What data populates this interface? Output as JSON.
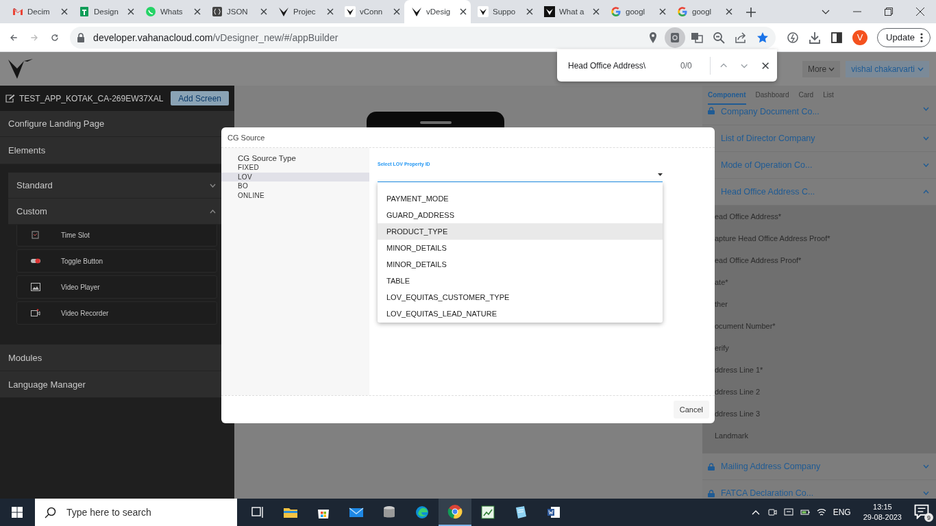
{
  "browser": {
    "tabs": [
      {
        "title": "Decim",
        "kind": "gmail",
        "selected": false
      },
      {
        "title": "Design",
        "kind": "sheets",
        "selected": false
      },
      {
        "title": "Whats",
        "kind": "whatsapp",
        "selected": false
      },
      {
        "title": "JSON",
        "kind": "json",
        "selected": false
      },
      {
        "title": "Projec",
        "kind": "vplain",
        "selected": false
      },
      {
        "title": "vConn",
        "kind": "vbox",
        "selected": false
      },
      {
        "title": "vDesig",
        "kind": "vplain",
        "selected": true
      },
      {
        "title": "Suppo",
        "kind": "vbox",
        "selected": false
      },
      {
        "title": "What a",
        "kind": "vblack",
        "selected": false
      },
      {
        "title": "googl",
        "kind": "google",
        "selected": false
      },
      {
        "title": "googl",
        "kind": "google",
        "selected": false
      }
    ],
    "address": {
      "host": "developer.vahanacloud.com",
      "path": "/vDesigner_new/#/appBuilder"
    },
    "profile_initial": "V",
    "update_button": "Update"
  },
  "find_bar": {
    "query": "Head Office Address\\",
    "count": "0/0"
  },
  "app": {
    "header": {
      "more": "More",
      "user": "vishal chakarvarti"
    },
    "sidebar": {
      "project": "TEST_APP_KOTAK_CA-269EW37XAL",
      "add_button": "Add Screen",
      "top_sections": [
        {
          "label": "Configure Landing Page"
        },
        {
          "label": "Elements"
        }
      ],
      "element_groups": [
        {
          "label": "Standard",
          "expanded": false
        },
        {
          "label": "Custom",
          "expanded": true
        }
      ],
      "custom_items": [
        {
          "label": "Time Slot",
          "kind": "calendar"
        },
        {
          "label": "Toggle Button",
          "kind": "toggle"
        },
        {
          "label": "Video Player",
          "kind": "image"
        },
        {
          "label": "Video Recorder",
          "kind": "camera"
        }
      ],
      "bottom_sections": [
        {
          "label": "Modules"
        },
        {
          "label": "Language Manager"
        }
      ]
    },
    "right_panel": {
      "tabs": [
        {
          "label": "Component",
          "selected": true
        },
        {
          "label": "Dashboard",
          "selected": false
        },
        {
          "label": "Card",
          "selected": false
        },
        {
          "label": "List",
          "selected": false
        }
      ],
      "sections": [
        {
          "title": "Company Document Co...",
          "locked": true,
          "expanded": false
        },
        {
          "title": "List of Director Company",
          "expanded": false
        },
        {
          "title": "Mode of Operation Co...",
          "expanded": false
        },
        {
          "title": "Head Office Address C...",
          "expanded": true,
          "fields": [
            "ead Office Address*",
            "apture Head Office Address Proof*",
            "ead Office Address Proof*",
            "ate*",
            "ther",
            "ocument Number*",
            "erify",
            "ddress Line 1*",
            "ddress Line 2",
            "ddress Line 3",
            "Landmark"
          ]
        },
        {
          "title": "Mailing Address Company",
          "locked": true,
          "expanded": false
        },
        {
          "title": "FATCA Declaration Co...",
          "locked": true,
          "expanded": false
        }
      ]
    }
  },
  "modal": {
    "title": "CG Source",
    "source_type_label": "CG Source Type",
    "source_types": [
      {
        "label": "FIXED",
        "selected": false
      },
      {
        "label": "LOV",
        "selected": true
      },
      {
        "label": "BO",
        "selected": false
      },
      {
        "label": "ONLINE",
        "selected": false
      }
    ],
    "lov_field": {
      "label": "Select LOV Property ID"
    },
    "options": [
      {
        "label": "PAYMENT_MODE",
        "highlighted": false
      },
      {
        "label": "GUARD_ADDRESS",
        "highlighted": false
      },
      {
        "label": "PRODUCT_TYPE",
        "highlighted": true
      },
      {
        "label": "MINOR_DETAILS",
        "highlighted": false
      },
      {
        "label": "MINOR_DETAILS",
        "highlighted": false
      },
      {
        "label": "TABLE",
        "highlighted": false
      },
      {
        "label": "LOV_EQUITAS_CUSTOMER_TYPE",
        "highlighted": false
      },
      {
        "label": "LOV_EQUITAS_LEAD_NATURE",
        "highlighted": false
      }
    ],
    "cancel_button": "Cancel"
  },
  "taskbar": {
    "search_placeholder": "Type here to search",
    "apps": [
      {
        "kind": "taskview",
        "active": false
      },
      {
        "kind": "folder",
        "active": false
      },
      {
        "kind": "store",
        "active": false
      },
      {
        "kind": "mail",
        "active": false
      },
      {
        "kind": "database",
        "active": false
      },
      {
        "kind": "edge",
        "active": false
      },
      {
        "kind": "chrome",
        "active": true
      },
      {
        "kind": "chart",
        "active": false
      },
      {
        "kind": "notepad",
        "active": false
      },
      {
        "kind": "word",
        "active": false
      }
    ],
    "language": "ENG",
    "time": "13:15",
    "date": "29-08-2023",
    "notifications": "9"
  }
}
